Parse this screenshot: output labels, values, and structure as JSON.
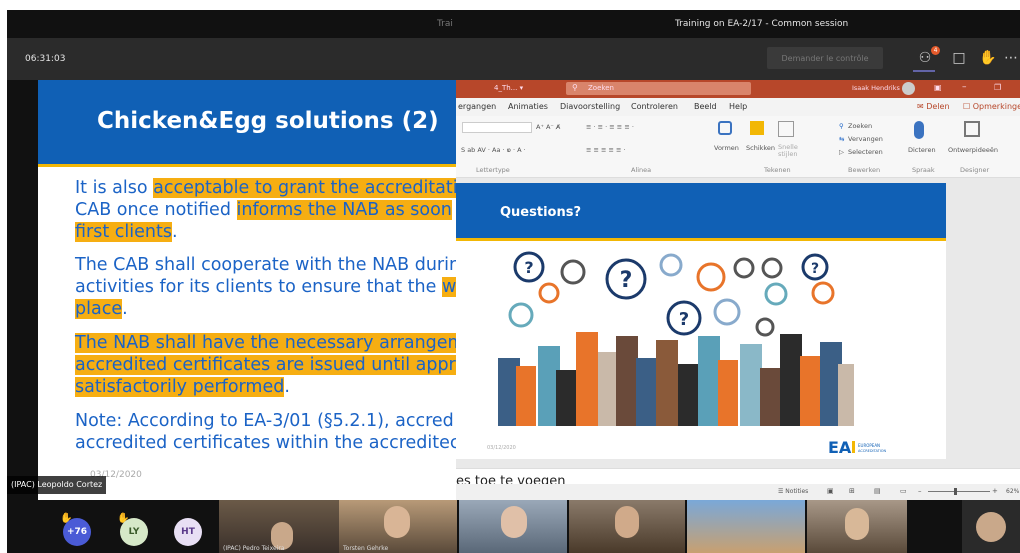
{
  "window": {
    "title_left": "Trai",
    "title_right": "Training on EA-2/17 - Common session"
  },
  "call": {
    "timer": "06:31:03",
    "request_control": "Demander le contrôle",
    "participants_badge": "4"
  },
  "slide_left": {
    "title": "Chicken&Egg solutions (2)",
    "lines": [
      [
        {
          "t": "It is also ",
          "h": false
        },
        {
          "t": "acceptable to grant the accreditati",
          "h": true
        }
      ],
      [
        {
          "t": "CAB once notified ",
          "h": false
        },
        {
          "t": "informs the NAB as soon",
          "h": true
        }
      ],
      [
        {
          "t": "first clients",
          "h": true
        },
        {
          "t": ".",
          "h": false
        }
      ],
      [
        {
          "t": "The CAB shall cooperate with the NAB durir",
          "h": false
        }
      ],
      [
        {
          "t": "activities for its clients to ensure that the ",
          "h": false
        },
        {
          "t": "w",
          "h": true
        }
      ],
      [
        {
          "t": "place",
          "h": true
        },
        {
          "t": ".",
          "h": false
        }
      ],
      [
        {
          "t": "The NAB shall have the necessary arrangem",
          "h": true
        }
      ],
      [
        {
          "t": "accredited certificates are issued until appro",
          "h": true
        }
      ],
      [
        {
          "t": "satisfactorily performed",
          "h": true
        },
        {
          "t": ".",
          "h": false
        }
      ],
      [
        {
          "t": "Note: According to EA-3/01 (§5.2.1), accred",
          "h": false
        }
      ],
      [
        {
          "t": "accredited certificates within the accreditec",
          "h": false
        }
      ]
    ],
    "date": "03/12/2020",
    "presenter": "(IPAC) Leopoldo Cortez"
  },
  "ppt": {
    "title_file": "4_Th... ▾",
    "search": "Zoeken",
    "user": "Isaak Hendriks",
    "tabs": [
      "ergangen",
      "Animaties",
      "Diavoorstelling",
      "Controleren",
      "Beeld",
      "Help"
    ],
    "tab_right": [
      "Delen",
      "Opmerkingen"
    ],
    "groups": [
      "Lettertype",
      "Alinea",
      "Tekenen",
      "Bewerken",
      "Spraak",
      "Designer"
    ],
    "ribbon": {
      "vormen": "Vormen",
      "schikken": "Schikken",
      "snelle_stijlen": "Snelle stijlen",
      "zoeken": "Zoeken",
      "vervangen": "Vervangen",
      "selecteren": "Selecteren",
      "dicteren": "Dicteren",
      "ontwerp": "Ontwerpideeën"
    },
    "slide_title": "Questions?",
    "slide_date": "03/12/2020",
    "ea_text": "EUROPEAN ACCREDITATION",
    "notes": "es toe te voegen",
    "status_notes": "Notities",
    "zoom": "62%"
  },
  "participants": {
    "more": "+76",
    "avatars": [
      "LY",
      "HT"
    ],
    "labels": [
      "(IPAC) Pedro Teixeira",
      "Torsten Gehrke"
    ]
  }
}
